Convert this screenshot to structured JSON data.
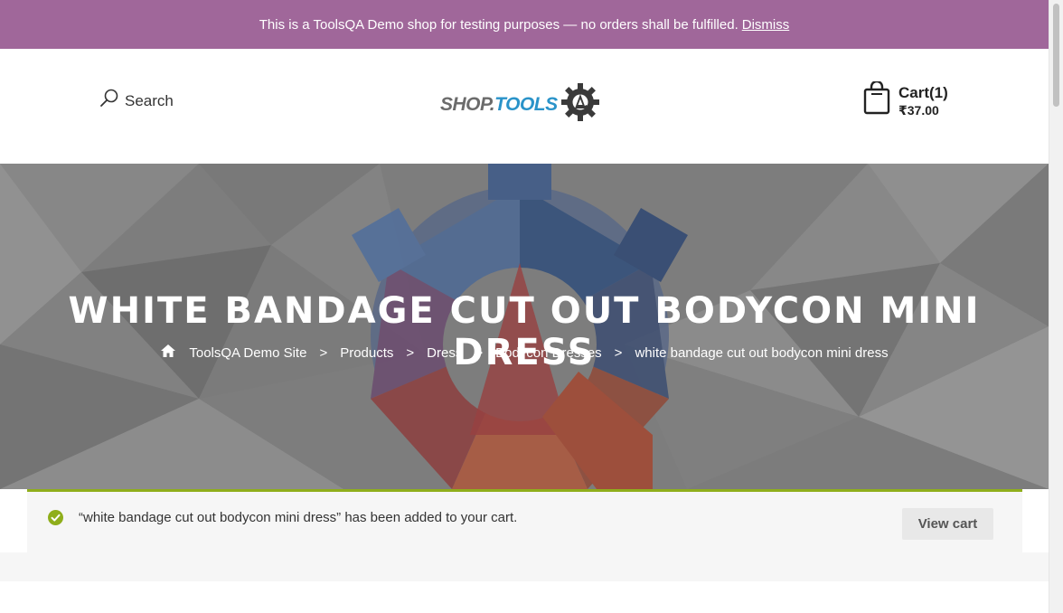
{
  "notice": {
    "text": "This is a ToolsQA Demo shop for testing purposes — no orders shall be fulfilled.",
    "dismiss": "Dismiss"
  },
  "header": {
    "search_label": "Search",
    "logo_part1": "SHOP.",
    "logo_part2": "TOOLS",
    "cart_label": "Cart(1)",
    "cart_total": "₹37.00"
  },
  "hero": {
    "title": "WHITE BANDAGE CUT OUT BODYCON MINI DRESS",
    "breadcrumb": [
      "ToolsQA Demo Site",
      "Products",
      "Dress",
      "Bodycon Dresses",
      "white bandage cut out bodycon mini dress"
    ],
    "separator": ">"
  },
  "message": {
    "text": "“white bandage cut out bodycon mini dress” has been added to your cart.",
    "view_cart": "View cart"
  },
  "colors": {
    "notice_bg": "#a0679a",
    "success_border": "#8fae1b",
    "success_icon": "#8fae1b",
    "logo_blue": "#2a93c9"
  },
  "icons": [
    "search-icon",
    "logo-gear-icon",
    "shopping-bag-icon",
    "home-icon",
    "check-circle-icon"
  ]
}
